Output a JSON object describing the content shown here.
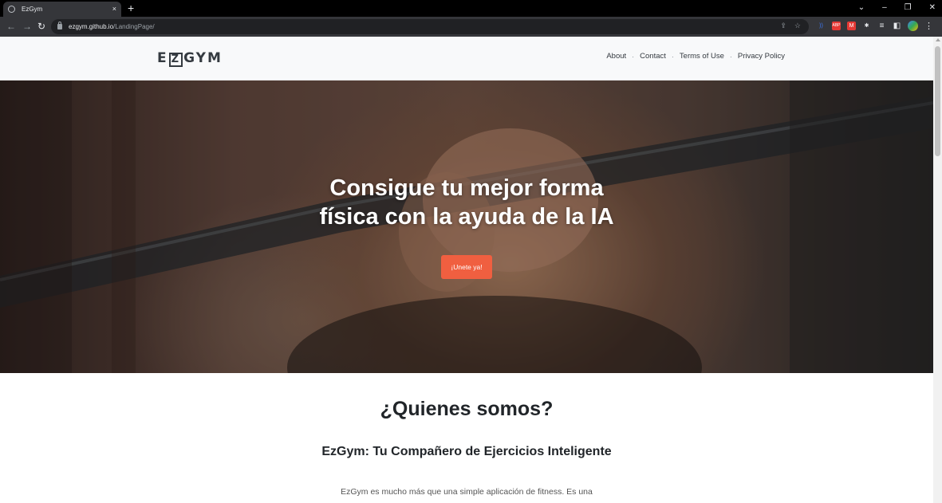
{
  "browser": {
    "tab_title": "EzGym",
    "tab_close": "×",
    "new_tab": "+",
    "url_host": "ezgym.github.io",
    "url_path": "/LandingPage/",
    "window_controls": [
      "⌄",
      "–",
      "❐",
      "✕"
    ],
    "omnibox_icons": [
      "⇪",
      "☆"
    ],
    "extensions": [
      {
        "icon": "audio-icon",
        "label": "))",
        "color": "#3d7bfd"
      },
      {
        "icon": "adblock-icon",
        "label": "ABP",
        "color": "#e53935"
      },
      {
        "icon": "extension-red-icon",
        "label": "M",
        "color": "#e53935"
      },
      {
        "icon": "puzzle-icon",
        "label": "✱",
        "color": "#35363a"
      },
      {
        "icon": "reading-list-icon",
        "label": "≡",
        "color": "#35363a"
      },
      {
        "icon": "side-panel-icon",
        "label": "◧",
        "color": "#35363a"
      }
    ],
    "menu_label": "⋮"
  },
  "navbar": {
    "brand": "EZGYM",
    "brand_parts": [
      "E",
      "Z",
      "GYM"
    ],
    "links": [
      "About",
      "Contact",
      "Terms of Use",
      "Privacy Policy"
    ],
    "separator": "·"
  },
  "hero": {
    "title_line1": "Consigue tu mejor forma",
    "title_line2": "física con la ayuda de la IA",
    "cta_label": "¡Unete ya!"
  },
  "about": {
    "title": "¿Quienes somos?",
    "subtitle": "EzGym: Tu Compañero de Ejercicios Inteligente",
    "paragraph": "EzGym es mucho más que una simple aplicación de fitness. Es una"
  },
  "colors": {
    "accent": "#f05f40",
    "navbar_bg": "#f8f9fa",
    "text_dark": "#212529"
  }
}
